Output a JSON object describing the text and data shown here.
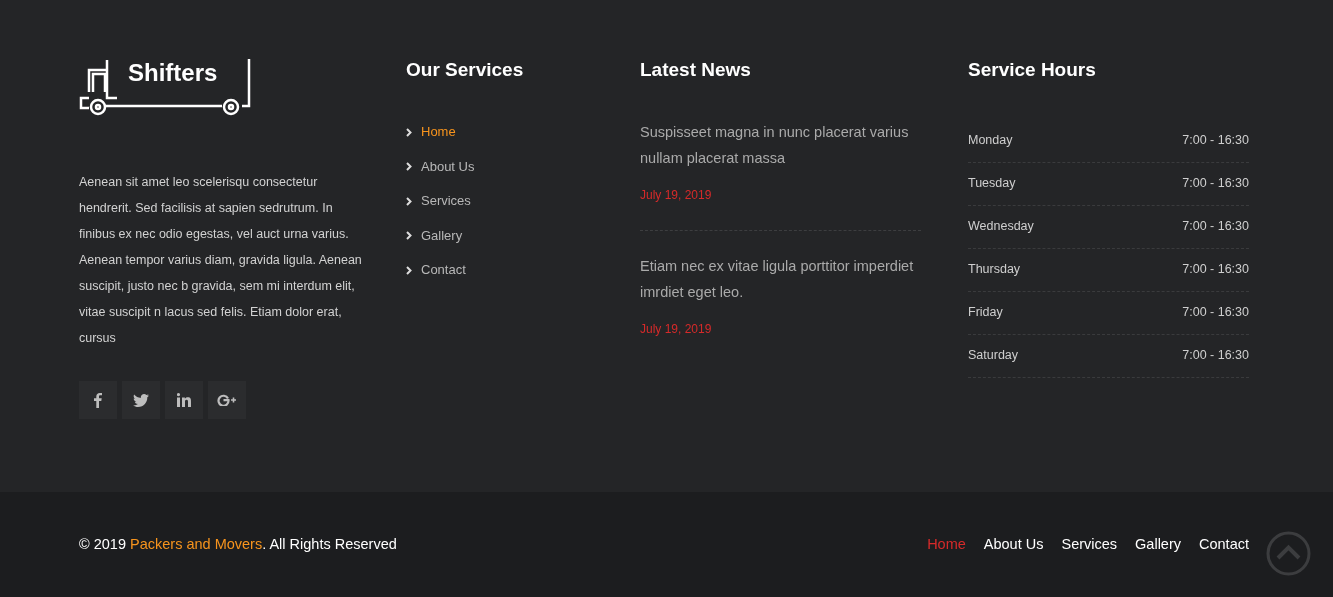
{
  "brand": {
    "name": "Shifters"
  },
  "about": {
    "text": "Aenean sit amet leo scelerisqu consectetur hendrerit. Sed facilisis at sapien sedrutrum. In finibus ex nec odio egestas, vel auct urna varius. Aenean tempor varius diam, gravida ligula. Aenean suscipit, justo nec b gravida, sem mi interdum elit, vitae suscipit n lacus sed felis. Etiam dolor erat, cursus"
  },
  "social": [
    {
      "kind": "facebook"
    },
    {
      "kind": "twitter"
    },
    {
      "kind": "linkedin"
    },
    {
      "kind": "googleplus"
    }
  ],
  "services": {
    "title": "Our Services",
    "items": [
      {
        "label": "Home",
        "selected": true
      },
      {
        "label": "About Us",
        "selected": false
      },
      {
        "label": "Services",
        "selected": false
      },
      {
        "label": "Gallery",
        "selected": false
      },
      {
        "label": "Contact",
        "selected": false
      }
    ]
  },
  "news": {
    "title": "Latest News",
    "items": [
      {
        "headline": "Suspisseet magna in nunc placerat varius nullam placerat massa",
        "date": "July 19, 2019"
      },
      {
        "headline": "Etiam nec ex vitae ligula porttitor imperdiet imrdiet eget leo.",
        "date": "July 19, 2019"
      }
    ]
  },
  "hours": {
    "title": "Service Hours",
    "rows": [
      {
        "day": "Monday",
        "time": "7:00 - 16:30"
      },
      {
        "day": "Tuesday",
        "time": "7:00 - 16:30"
      },
      {
        "day": "Wednesday",
        "time": "7:00 - 16:30"
      },
      {
        "day": "Thursday",
        "time": "7:00 - 16:30"
      },
      {
        "day": "Friday",
        "time": "7:00 - 16:30"
      },
      {
        "day": "Saturday",
        "time": "7:00 - 16:30"
      }
    ]
  },
  "bottom_bar": {
    "copyright_before": "© 2019 ",
    "copyright_link": "Packers and Movers",
    "copyright_after": ". All Rights Reserved",
    "nav": [
      {
        "label": "Home",
        "selected": true
      },
      {
        "label": "About Us",
        "selected": false
      },
      {
        "label": "Services",
        "selected": false
      },
      {
        "label": "Gallery",
        "selected": false
      },
      {
        "label": "Contact",
        "selected": false
      }
    ]
  }
}
